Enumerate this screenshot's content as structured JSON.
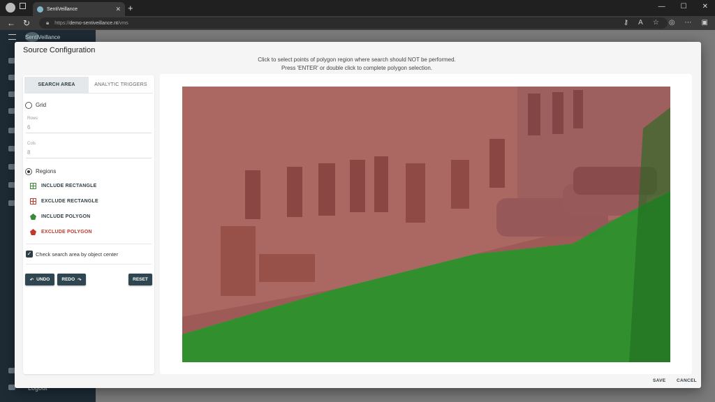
{
  "browser": {
    "tab_title": "SentiVeillance",
    "url_scheme": "https://",
    "url_host": "demo-sentiveillance.nt",
    "url_path": "/vms"
  },
  "app": {
    "brand": "SentiVeillance",
    "logout_label": "Logout"
  },
  "dialog": {
    "title": "Source Configuration",
    "instruction_line1": "Click to select points of polygon region where search should NOT be performed.",
    "instruction_line2": "Press 'ENTER' or double click to complete polygon selection.",
    "tabs": [
      {
        "label": "SEARCH AREA",
        "active": true
      },
      {
        "label": "ANALYTIC TRIGGERS",
        "active": false
      }
    ],
    "grid": {
      "label": "Grid",
      "selected": false,
      "rows_label": "Rows",
      "rows_value": "6",
      "cols_label": "Cols",
      "cols_value": "8"
    },
    "regions": {
      "label": "Regions",
      "selected": true,
      "items": [
        {
          "label": "INCLUDE RECTANGLE",
          "icon": "include-rectangle-icon",
          "color": "#3a8a3a"
        },
        {
          "label": "EXCLUDE RECTANGLE",
          "icon": "exclude-rectangle-icon",
          "color": "#c0392b"
        },
        {
          "label": "INCLUDE POLYGON",
          "icon": "include-polygon-icon",
          "color": "#3a8a3a"
        },
        {
          "label": "EXCLUDE POLYGON",
          "icon": "exclude-polygon-icon",
          "color": "#c0392b"
        }
      ]
    },
    "check_by_center": {
      "label": "Check search area by object center",
      "checked": true
    },
    "buttons": {
      "undo": "UNDO",
      "redo": "REDO",
      "reset": "RESET"
    },
    "footer": {
      "save": "SAVE",
      "cancel": "CANCEL"
    }
  },
  "colors": {
    "include_overlay": "#1f8f1f",
    "exclude_overlay": "#a03030",
    "primary_button": "#2f4650"
  }
}
